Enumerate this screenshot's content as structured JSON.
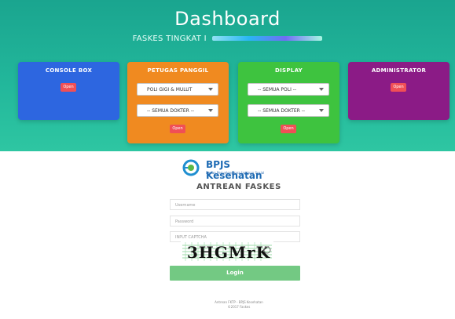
{
  "header": {
    "title": "Dashboard",
    "subtitle": "FASKES TINGKAT I"
  },
  "cards": [
    {
      "title": "CONSOLE BOX",
      "button": "Open",
      "color": "#2d66e0"
    },
    {
      "title": "PETUGAS PANGGIL",
      "select1": "POLI GIGI & MULUT",
      "select2": "-- SEMUA DOKTER --",
      "button": "Open",
      "color": "#f08a20"
    },
    {
      "title": "DISPLAY",
      "select1": "-- SEMUA POLI --",
      "select2": "-- SEMUA DOKTER --",
      "button": "Open",
      "color": "#3ec33f"
    },
    {
      "title": "ADMINISTRATOR",
      "button": "Open",
      "color": "#8b1b86"
    }
  ],
  "login": {
    "brand": "BPJS Kesehatan",
    "brand_sub": "Badan Penyelenggara Jaminan Sosial",
    "heading": "ANTREAN FASKES",
    "username_placeholder": "Username",
    "password_placeholder": "Password",
    "captcha_placeholder": "INPUT CAPTCHA",
    "captcha_text": "3HGMrK",
    "button": "Login",
    "footer_line1": "Antrean FKTP - BPJS Kesehatan",
    "footer_line2": "©2017 Faskes",
    "accent": "#73c983"
  }
}
